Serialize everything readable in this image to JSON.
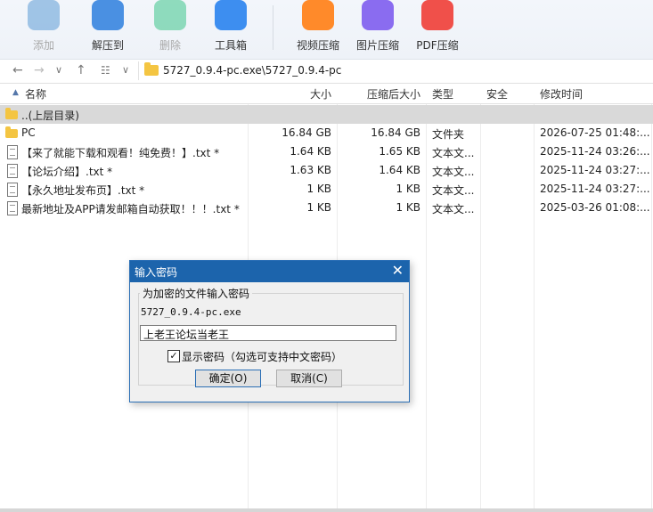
{
  "toolbar": {
    "buttons": [
      {
        "label": "添加",
        "enabled": false,
        "color": "#5b9bd5"
      },
      {
        "label": "解压到",
        "enabled": true,
        "color": "#4a90e2"
      },
      {
        "label": "删除",
        "enabled": false,
        "color": "#3cc48a"
      },
      {
        "label": "工具箱",
        "enabled": true,
        "color": "#3d8ef0"
      },
      {
        "label": "视频压缩",
        "enabled": true,
        "color": "#ff8a2a"
      },
      {
        "label": "图片压缩",
        "enabled": true,
        "color": "#8a6cf0"
      },
      {
        "label": "PDF压缩",
        "enabled": true,
        "color": "#f0504a"
      }
    ]
  },
  "address": {
    "path": "5727_0.9.4-pc.exe\\5727_0.9.4-pc"
  },
  "columns": {
    "name": "名称",
    "size": "大小",
    "packed": "压缩后大小",
    "type": "类型",
    "security": "安全",
    "modified": "修改时间"
  },
  "rows": [
    {
      "name": "..(上层目录)",
      "size": "",
      "packed": "",
      "type": "",
      "modified": "",
      "icon": "folder-up"
    },
    {
      "name": "PC",
      "size": "16.84 GB",
      "packed": "16.84 GB",
      "type": "文件夹",
      "modified": "2026-07-25 01:48:...",
      "icon": "folder"
    },
    {
      "name": "【来了就能下载和观看！纯免费！】.txt *",
      "size": "1.64 KB",
      "packed": "1.65 KB",
      "type": "文本文...",
      "modified": "2025-11-24 03:26:...",
      "icon": "document"
    },
    {
      "name": "【论坛介绍】.txt *",
      "size": "1.63 KB",
      "packed": "1.64 KB",
      "type": "文本文...",
      "modified": "2025-11-24 03:27:...",
      "icon": "document"
    },
    {
      "name": "【永久地址发布页】.txt *",
      "size": "1 KB",
      "packed": "1 KB",
      "type": "文本文...",
      "modified": "2025-11-24 03:27:...",
      "icon": "document"
    },
    {
      "name": "最新地址及APP请发邮箱自动获取！！！.txt *",
      "size": "1 KB",
      "packed": "1 KB",
      "type": "文本文...",
      "modified": "2025-03-26 01:08:...",
      "icon": "document"
    }
  ],
  "dialog": {
    "title": "输入密码",
    "group_title": "为加密的文件输入密码",
    "filename": "5727_0.9.4-pc.exe",
    "password_value": "上老王论坛当老王",
    "show_password_label": "显示密码（勾选可支持中文密码）",
    "show_password_checked": true,
    "ok_label": "确定(O)",
    "cancel_label": "取消(C)"
  }
}
